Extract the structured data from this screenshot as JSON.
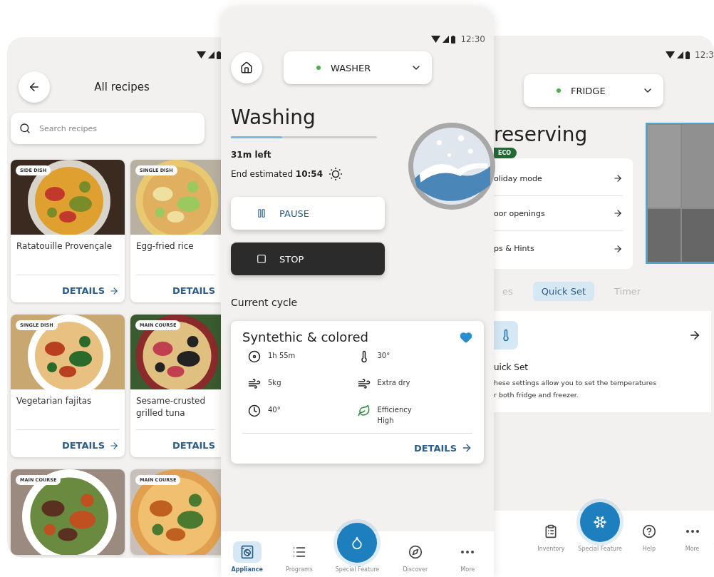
{
  "recipes_screen": {
    "title": "All recipes",
    "search": {
      "placeholder": "Search recipes"
    },
    "recipes": [
      {
        "tag": "SIDE DISH",
        "name": "Ratatouille Provençale",
        "action": "DETAILS"
      },
      {
        "tag": "SINGLE DISH",
        "name": "Egg-fried rice",
        "action": "DETAILS"
      },
      {
        "tag": "SINGLE DISH",
        "name": "Vegetarian fajitas",
        "action": "DETAILS"
      },
      {
        "tag": "MAIN COURSE",
        "name": "Sesame-crusted grilled tuna",
        "action": "DETAILS"
      },
      {
        "tag": "MAIN COURSE"
      },
      {
        "tag": "MAIN COURSE"
      }
    ]
  },
  "washer_screen": {
    "time": "12:30",
    "device": {
      "name": "WASHER",
      "color": "#4caf50"
    },
    "title": "Washing",
    "progress": {
      "level": 0.35
    },
    "remaining": "31m left",
    "end_estimate": "End estimated **10:54**",
    "buttons": [
      {
        "kind": "pause",
        "label": "PAUSE"
      },
      {
        "kind": "stop",
        "label": "STOP"
      }
    ],
    "section_title": "Current cycle",
    "cycle": {
      "name": "Syntethic & colored",
      "favorite": true,
      "action": "DETAILS",
      "specs": [
        {
          "kind": "duration",
          "value": "1h 55m"
        },
        {
          "kind": "temperature",
          "value": "30°"
        },
        {
          "kind": "load",
          "value": "5kg"
        },
        {
          "kind": "dry",
          "value": "Extra dry"
        },
        {
          "kind": "time",
          "value": "40°"
        },
        {
          "kind": "efficiency",
          "label": "Efficiency",
          "value": "High"
        }
      ]
    },
    "nav": [
      {
        "kind": "appliance",
        "label": "Appliance",
        "selected": true
      },
      {
        "kind": "programs",
        "label": "Programs",
        "selected": false
      },
      {
        "kind": "special",
        "label": "Special Feature",
        "selected": false
      },
      {
        "kind": "discover",
        "label": "Discover",
        "selected": false
      },
      {
        "kind": "more",
        "label": "More",
        "selected": false
      }
    ]
  },
  "fridge_screen": {
    "time": "12:3",
    "device": {
      "name": "FRIDGE",
      "color": "#4caf50"
    },
    "title": "reserving",
    "badge": "ECO",
    "menu": [
      "oliday mode",
      "oor openings",
      "ps & Hints"
    ],
    "tabs": [
      {
        "label": "es",
        "selected": false
      },
      {
        "label": "Quick Set",
        "selected": true
      },
      {
        "label": "Timer",
        "selected": false
      }
    ],
    "card": {
      "title": "uick Set",
      "lines": [
        "hese settings allow you to set the temperatures",
        "r both fridge and freezer."
      ]
    },
    "nav": [
      {
        "kind": "inventory",
        "label": "Inventory",
        "selected": false
      },
      {
        "kind": "special",
        "label": "Special Feature",
        "selected": false
      },
      {
        "kind": "help",
        "label": "Help",
        "selected": false
      },
      {
        "kind": "more",
        "label": "More",
        "selected": false
      }
    ]
  }
}
